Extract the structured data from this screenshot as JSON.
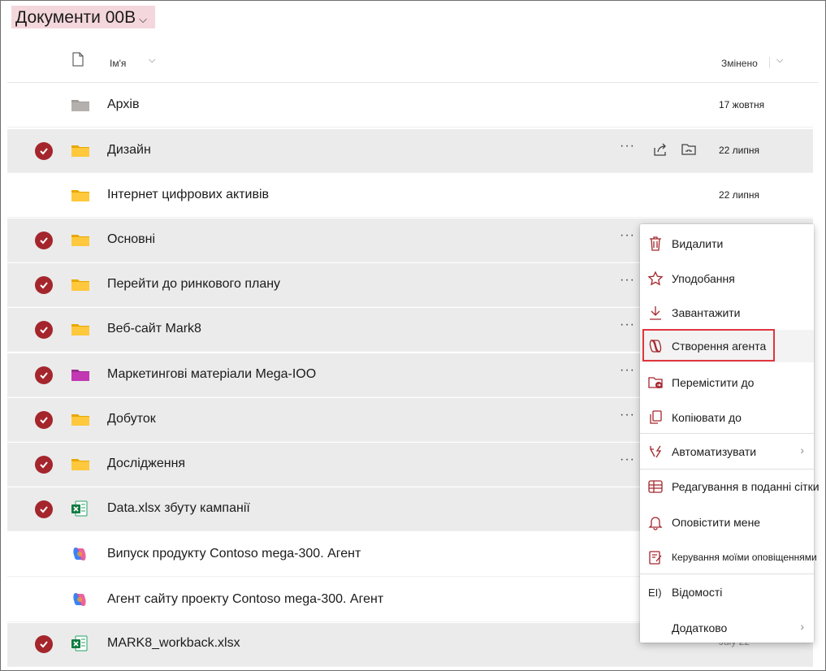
{
  "title": {
    "text": "Документи 00В",
    "chevron": "⌵"
  },
  "header": {
    "name": "Ім'я",
    "modified": "Змінено"
  },
  "rows": [
    {
      "name": "Архів",
      "date": "17 жовтня",
      "icon": "folder-gray-icon"
    },
    {
      "name": "Дизайн",
      "date": "22 липня",
      "icon": "folder-icon",
      "more": "···"
    },
    {
      "name": "Інтернет цифрових активів",
      "date": "22 липня",
      "icon": "folder-icon"
    },
    {
      "name": "Основні",
      "icon": "folder-icon",
      "more": "···"
    },
    {
      "name": "Перейти до ринкового плану",
      "icon": "folder-icon",
      "more": "···"
    },
    {
      "name": "Веб-сайт Mark8",
      "icon": "folder-icon",
      "more": "···"
    },
    {
      "name": "Маркетингові матеріали Mega-IOO",
      "icon": "folder-pink-icon",
      "more": "···"
    },
    {
      "name": "Добуток",
      "icon": "folder-icon",
      "more": "···"
    },
    {
      "name": "Дослідження",
      "icon": "folder-icon",
      "more": "···"
    },
    {
      "name": "Data.xlsx збуту кампанії",
      "icon": "excel-icon"
    },
    {
      "name": "Випуск продукту Contoso mega-300. Агент",
      "icon": "copilot-agent-icon"
    },
    {
      "name": "Агент сайту проекту Contoso mega-300. Агент",
      "icon": "copilot-agent-icon"
    },
    {
      "name": "MARK8_workback.xlsx",
      "date": "July 22",
      "icon": "excel-icon"
    }
  ],
  "menu": {
    "delete": "Видалити",
    "favorite": "Уподобання",
    "download": "Завантажити",
    "create_agent": "Створення агента",
    "move_to": "Перемістити до",
    "copy_to": "Копіювати до",
    "automate": "Автоматизувати",
    "grid_edit": "Редагування в поданні сітки",
    "alert_me": "Оповістити мене",
    "manage_alerts": "Керування моїми оповіщеннями",
    "details_prefix": "EI)",
    "details": "Відомості",
    "more": "Додатково",
    "submenu_arrow": "›"
  },
  "colors": {
    "accent_red": "#a4262c",
    "folder_yellow": "#ffc83d",
    "folder_pink": "#c239b3",
    "highlight_box": "#e0353d"
  }
}
